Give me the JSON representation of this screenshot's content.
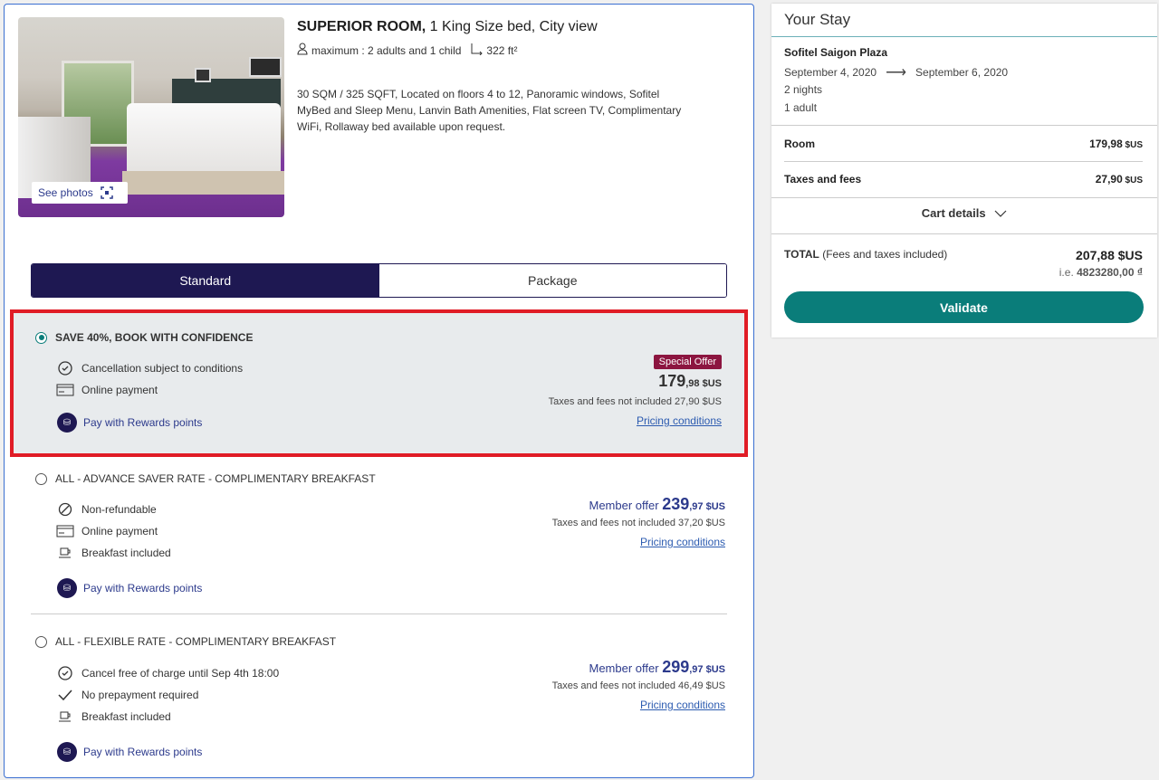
{
  "room": {
    "title": "SUPERIOR ROOM,",
    "title_rest": " 1 King Size bed, City view",
    "capacity": "maximum : 2 adults and 1 child",
    "size": "322 ft²",
    "description": "30 SQM / 325 SQFT, Located on floors 4 to 12, Panoramic windows, Sofitel MyBed and Sleep Menu, Lanvin Bath Amenities, Flat screen TV, Complimentary WiFi, Rollaway bed available upon request.",
    "see_photos": "See photos"
  },
  "tabs": [
    {
      "label": "Standard",
      "active": true
    },
    {
      "label": "Package",
      "active": false
    }
  ],
  "rates": [
    {
      "title": "SAVE 40%, BOOK WITH CONFIDENCE",
      "selected": true,
      "features": [
        {
          "icon": "clock-icon",
          "label": "Cancellation subject to conditions"
        },
        {
          "icon": "card-icon",
          "label": "Online payment"
        }
      ],
      "rewards": "Pay with Rewards points",
      "badge": "Special Offer",
      "price_int": "179",
      "price_dec": ",98 $US",
      "taxes": "Taxes and fees not included 27,90 $US",
      "pricing_link": "Pricing conditions"
    },
    {
      "title": "ALL - ADVANCE SAVER RATE - COMPLIMENTARY BREAKFAST",
      "selected": false,
      "features": [
        {
          "icon": "no-refund-icon",
          "label": "Non-refundable"
        },
        {
          "icon": "card-icon",
          "label": "Online payment"
        },
        {
          "icon": "cup-icon",
          "label": "Breakfast included"
        }
      ],
      "rewards": "Pay with Rewards points",
      "member_label": "Member offer",
      "price_int": "239",
      "price_dec": ",97 $US",
      "taxes": "Taxes and fees not included 37,20 $US",
      "pricing_link": "Pricing conditions"
    },
    {
      "title": "ALL - FLEXIBLE RATE - COMPLIMENTARY BREAKFAST",
      "selected": false,
      "features": [
        {
          "icon": "clock-icon",
          "label": "Cancel free of charge until Sep 4th 18:00"
        },
        {
          "icon": "check-icon",
          "label": "No prepayment required"
        },
        {
          "icon": "cup-icon",
          "label": "Breakfast included"
        }
      ],
      "rewards": "Pay with Rewards points",
      "member_label": "Member offer",
      "price_int": "299",
      "price_dec": ",97 $US",
      "taxes": "Taxes and fees not included 46,49 $US",
      "pricing_link": "Pricing conditions"
    }
  ],
  "stay": {
    "heading": "Your Stay",
    "hotel": "Sofitel Saigon Plaza",
    "check_in": "September 4, 2020",
    "check_out": "September 6, 2020",
    "nights": "2 nights",
    "guests": "1 adult",
    "room_label": "Room",
    "room_price": "179,98",
    "room_currency": " $US",
    "taxes_label": "Taxes and fees",
    "taxes_price": "27,90",
    "taxes_currency": " $US",
    "cart_details": "Cart details",
    "total_label": "TOTAL",
    "total_note": " (Fees and taxes included)",
    "total_value": "207,88 $US",
    "local_prefix": "i.e. ",
    "local_value": "4823280,00 ₫",
    "validate": "Validate"
  },
  "colors": {
    "primary": "#1e1852",
    "accent": "#0a7d7a",
    "highlight_border": "#e01c26",
    "special_badge": "#8c1540",
    "link": "#2c3a8c"
  }
}
